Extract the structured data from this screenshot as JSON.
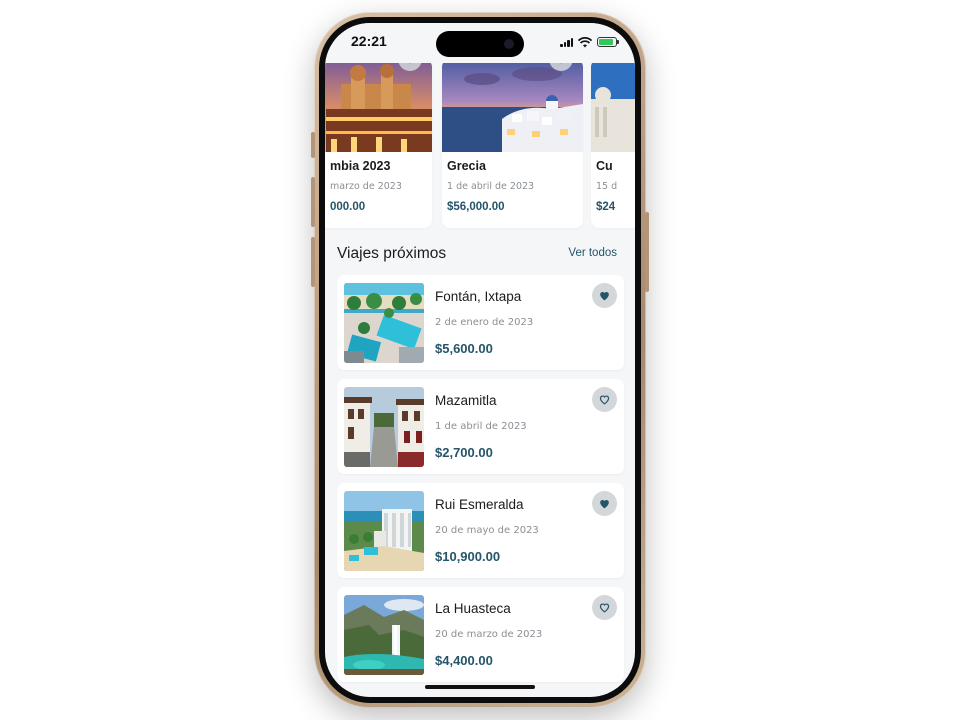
{
  "status_bar": {
    "time": "22:21"
  },
  "featured": [
    {
      "name": "mbia 2023",
      "date": "marzo de 2023",
      "price": "000.00",
      "favorite": true
    },
    {
      "name": "Grecia",
      "date": "1 de abril de 2023",
      "price": "$56,000.00",
      "favorite": true
    },
    {
      "name": "Cu",
      "date": "15 d",
      "price": "$24",
      "favorite": false
    }
  ],
  "upcoming": {
    "title": "Viajes próximos",
    "see_all": "Ver todos",
    "trips": [
      {
        "name": "Fontán, Ixtapa",
        "date": "2 de enero de 2023",
        "price": "$5,600.00",
        "favorite": true,
        "icon": "heart-filled-icon"
      },
      {
        "name": "Mazamitla",
        "date": "1 de abril de 2023",
        "price": "$2,700.00",
        "favorite": false,
        "icon": "heart-outline-icon"
      },
      {
        "name": "Rui Esmeralda",
        "date": "20 de mayo de 2023",
        "price": "$10,900.00",
        "favorite": true,
        "icon": "heart-filled-icon"
      },
      {
        "name": "La Huasteca",
        "date": "20 de marzo de 2023",
        "price": "$4,400.00",
        "favorite": false,
        "icon": "heart-outline-icon"
      }
    ]
  },
  "colors": {
    "accent": "#24556a",
    "background": "#f4f6f8",
    "card": "#ffffff",
    "muted_text": "#8a8f94",
    "heart_button": "#d3d7da"
  }
}
